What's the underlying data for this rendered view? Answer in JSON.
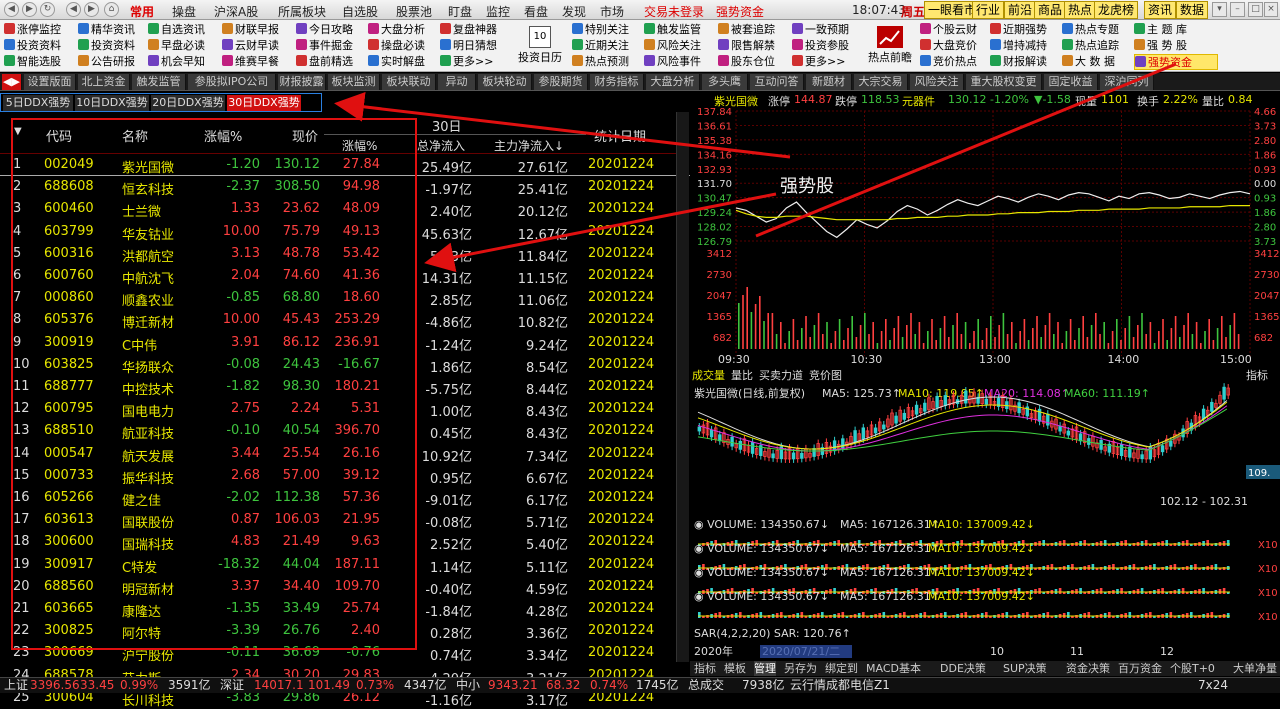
{
  "topbar": {
    "menus": [
      "常用",
      "操盘",
      "沪深A股",
      "所属板块",
      "自选股",
      "股票池",
      "盯盘",
      "监控",
      "看盘",
      "发现",
      "市场"
    ],
    "login": "交易未登录",
    "strong_fund": "强势资金",
    "clock": "18:07:43",
    "weekday": "周五",
    "right_tabs": [
      "一眼看市",
      "行业",
      "前沿",
      "商品",
      "热点",
      "龙虎榜",
      "资讯",
      "数据"
    ]
  },
  "toolbar": {
    "col1": [
      "涨停监控",
      "投资资料",
      "智能选股"
    ],
    "col2": [
      "精华资讯",
      "投资资料",
      "公告研报"
    ],
    "col3": [
      "自选资讯",
      "早盘必读",
      "机会早知"
    ],
    "col4": [
      "财联早报",
      "云财早读",
      "维赛早餐"
    ],
    "col5": [
      "今日攻略",
      "事件掘金",
      "盘前精选"
    ],
    "col6": [
      "大盘分析",
      "操盘必读",
      "实时解盘"
    ],
    "col7": [
      "复盘神器",
      "明日猜想",
      "更多>>"
    ],
    "cal_num": "10",
    "cal_label": "投资日历",
    "col8": [
      "特别关注",
      "近期关注",
      "热点预测"
    ],
    "col9": [
      "触发监管",
      "风险关注",
      "风险事件"
    ],
    "col10": [
      "被套追踪",
      "限售解禁",
      "股东仓位"
    ],
    "col11": [
      "一致预期",
      "投资参股",
      "更多>>"
    ],
    "hot_label": "热点前瞻",
    "col12": [
      "个股云财",
      "大盘竞价",
      "竞价热点"
    ],
    "col13": [
      "近期强势",
      "增持减持",
      "财报解读"
    ],
    "col14": [
      "热点专题",
      "热点追踪",
      "大 数 据"
    ],
    "col15": [
      "主 题 库",
      "强 势 股",
      "强势资金"
    ]
  },
  "tabs": [
    "设置版面",
    "北上资金",
    "触发监管",
    "参股拟IPO公司",
    "财报披露",
    "板块监测",
    "板块联动",
    "异动",
    "板块轮动",
    "参股期货",
    "财务指标",
    "大盘分析",
    "多头鹰",
    "互动问答",
    "新题材",
    "大宗交易",
    "风险关注",
    "重大股权变更",
    "固定收益",
    "深沪同列"
  ],
  "subtabs": [
    "5日DDX强势",
    "10日DDX强势",
    "20日DDX强势",
    "30日DDX强势"
  ],
  "table": {
    "group_header": "30日",
    "headers": [
      "代码",
      "名称",
      "涨幅%",
      "现价",
      "涨幅%",
      "总净流入",
      "主力净流入↓",
      "统计日期"
    ],
    "rows": [
      {
        "no": "1",
        "code": "002049",
        "name": "紫光国微",
        "pct": "-1.20",
        "price": "130.12",
        "p30": "27.84",
        "net": "25.49亿",
        "main": "27.61亿",
        "date": "20201224"
      },
      {
        "no": "2",
        "code": "688608",
        "name": "恒玄科技",
        "pct": "-2.37",
        "price": "308.50",
        "p30": "94.98",
        "net": "-1.97亿",
        "main": "25.41亿",
        "date": "20201224"
      },
      {
        "no": "3",
        "code": "600460",
        "name": "士兰微",
        "pct": "1.33",
        "price": "23.62",
        "p30": "48.09",
        "net": "2.40亿",
        "main": "20.12亿",
        "date": "20201224"
      },
      {
        "no": "4",
        "code": "603799",
        "name": "华友钴业",
        "pct": "10.00",
        "price": "75.79",
        "p30": "49.13",
        "net": "45.63亿",
        "main": "12.67亿",
        "date": "20201224"
      },
      {
        "no": "5",
        "code": "600316",
        "name": "洪都航空",
        "pct": "3.13",
        "price": "48.78",
        "p30": "53.42",
        "net": "5.53亿",
        "main": "11.84亿",
        "date": "20201224"
      },
      {
        "no": "6",
        "code": "600760",
        "name": "中航沈飞",
        "pct": "2.04",
        "price": "74.60",
        "p30": "41.36",
        "net": "14.31亿",
        "main": "11.15亿",
        "date": "20201224"
      },
      {
        "no": "7",
        "code": "000860",
        "name": "顺鑫农业",
        "pct": "-0.85",
        "price": "68.80",
        "p30": "18.60",
        "net": "2.85亿",
        "main": "11.06亿",
        "date": "20201224"
      },
      {
        "no": "8",
        "code": "605376",
        "name": "博迁新材",
        "pct": "10.00",
        "price": "45.43",
        "p30": "253.29",
        "net": "-4.86亿",
        "main": "10.82亿",
        "date": "20201224"
      },
      {
        "no": "9",
        "code": "300919",
        "name": "C中伟",
        "pct": "3.91",
        "price": "86.12",
        "p30": "236.91",
        "net": "-1.24亿",
        "main": "9.24亿",
        "date": "20201224"
      },
      {
        "no": "10",
        "code": "603825",
        "name": "华扬联众",
        "pct": "-0.08",
        "price": "24.43",
        "p30": "-16.67",
        "net": "1.86亿",
        "main": "8.54亿",
        "date": "20201224"
      },
      {
        "no": "11",
        "code": "688777",
        "name": "中控技术",
        "pct": "-1.82",
        "price": "98.30",
        "p30": "180.21",
        "net": "-5.75亿",
        "main": "8.44亿",
        "date": "20201224"
      },
      {
        "no": "12",
        "code": "600795",
        "name": "国电电力",
        "pct": "2.75",
        "price": "2.24",
        "p30": "5.31",
        "net": "1.00亿",
        "main": "8.43亿",
        "date": "20201224"
      },
      {
        "no": "13",
        "code": "688510",
        "name": "航亚科技",
        "pct": "-0.10",
        "price": "40.54",
        "p30": "396.70",
        "net": "0.45亿",
        "main": "8.43亿",
        "date": "20201224"
      },
      {
        "no": "14",
        "code": "000547",
        "name": "航天发展",
        "pct": "3.44",
        "price": "25.54",
        "p30": "26.16",
        "net": "10.92亿",
        "main": "7.34亿",
        "date": "20201224"
      },
      {
        "no": "15",
        "code": "000733",
        "name": "振华科技",
        "pct": "2.68",
        "price": "57.00",
        "p30": "39.12",
        "net": "0.95亿",
        "main": "6.67亿",
        "date": "20201224"
      },
      {
        "no": "16",
        "code": "605266",
        "name": "健之佳",
        "pct": "-2.02",
        "price": "112.38",
        "p30": "57.36",
        "net": "-9.01亿",
        "main": "6.17亿",
        "date": "20201224"
      },
      {
        "no": "17",
        "code": "603613",
        "name": "国联股份",
        "pct": "0.87",
        "price": "106.03",
        "p30": "21.95",
        "net": "-0.08亿",
        "main": "5.71亿",
        "date": "20201224"
      },
      {
        "no": "18",
        "code": "300600",
        "name": "国瑞科技",
        "pct": "4.83",
        "price": "21.49",
        "p30": "9.63",
        "net": "2.52亿",
        "main": "5.40亿",
        "date": "20201224"
      },
      {
        "no": "19",
        "code": "300917",
        "name": "C特发",
        "pct": "-18.32",
        "price": "44.04",
        "p30": "187.11",
        "net": "1.14亿",
        "main": "5.11亿",
        "date": "20201224"
      },
      {
        "no": "20",
        "code": "688560",
        "name": "明冠新材",
        "pct": "3.37",
        "price": "34.40",
        "p30": "109.70",
        "net": "-0.40亿",
        "main": "4.59亿",
        "date": "20201224"
      },
      {
        "no": "21",
        "code": "603665",
        "name": "康隆达",
        "pct": "-1.35",
        "price": "33.49",
        "p30": "25.74",
        "net": "-1.84亿",
        "main": "4.28亿",
        "date": "20201224"
      },
      {
        "no": "22",
        "code": "300825",
        "name": "阿尔特",
        "pct": "-3.39",
        "price": "26.76",
        "p30": "2.40",
        "net": "0.28亿",
        "main": "3.36亿",
        "date": "20201224"
      },
      {
        "no": "23",
        "code": "300669",
        "name": "沪宁股份",
        "pct": "-0.11",
        "price": "36.69",
        "p30": "-0.76",
        "net": "0.74亿",
        "main": "3.34亿",
        "date": "20201224"
      },
      {
        "no": "24",
        "code": "688578",
        "name": "艾力斯",
        "pct": "2.34",
        "price": "30.20",
        "p30": "29.83",
        "net": "-4.20亿",
        "main": "3.21亿",
        "date": "20201224"
      },
      {
        "no": "25",
        "code": "300604",
        "name": "长川科技",
        "pct": "-3.83",
        "price": "29.86",
        "p30": "26.12",
        "net": "-1.16亿",
        "main": "3.17亿",
        "date": "20201224"
      }
    ]
  },
  "annotation": "强势股",
  "quote": {
    "name": "紫光国微",
    "limit_up_label": "涨停",
    "limit_up": "144.87",
    "limit_dn_label": "跌停",
    "limit_dn": "118.53",
    "sector": "元器件",
    "price": "130.12",
    "pct": "-1.20%",
    "chg": "▼-1.58",
    "vol_label": "现量",
    "vol": "1101",
    "turnover_label": "换手",
    "turnover": "2.22%",
    "ratio_label": "量比",
    "ratio": "0.84"
  },
  "intraday": {
    "left_ticks": [
      "137.84",
      "136.61",
      "135.38",
      "134.16",
      "132.93",
      "131.70",
      "130.47",
      "129.24",
      "128.02",
      "126.79"
    ],
    "right_ticks": [
      "4.66",
      "3.73",
      "2.80",
      "1.86",
      "0.93",
      "0.00",
      "0.93",
      "1.86",
      "2.80",
      "3.73"
    ],
    "vol_ticks": [
      "3412",
      "2730",
      "2047",
      "1365",
      "682"
    ],
    "time_ticks": [
      "09:30",
      "10:30",
      "13:00",
      "14:00",
      "15:00"
    ],
    "price_series": [
      129.6,
      129.4,
      128.9,
      128.4,
      128.7,
      129.6,
      130.1,
      129.2,
      128.4,
      127.6,
      127.1,
      127.8,
      128.6,
      128.2,
      127.9,
      128.5,
      129.3,
      129.8,
      129.5,
      129.0,
      129.4,
      129.9,
      130.3,
      130.0,
      129.8,
      130.2,
      130.6,
      130.4,
      130.1,
      130.5,
      130.8,
      130.6,
      130.3,
      130.7,
      130.9,
      130.8,
      130.5,
      130.2,
      130.6,
      130.4,
      130.8,
      130.9,
      130.7,
      130.4,
      130.5,
      130.8,
      130.6,
      130.4,
      130.7,
      130.9,
      131.0,
      130.8
    ],
    "avg_series": [
      129.4,
      129.1,
      128.9,
      128.8,
      128.8,
      128.9,
      128.9,
      128.9,
      128.8,
      128.7,
      128.6,
      128.6,
      128.6,
      128.6,
      128.6,
      128.6,
      128.7,
      128.7,
      128.8,
      128.8,
      128.8,
      128.9,
      128.9,
      129.0,
      129.0,
      129.0,
      129.1,
      129.1,
      129.2,
      129.2,
      129.2,
      129.3,
      129.3,
      129.3,
      129.4,
      129.4,
      129.4,
      129.5,
      129.5,
      129.5,
      129.5,
      129.6,
      129.6,
      129.6,
      129.6,
      129.7,
      129.7,
      129.7,
      129.7,
      129.8,
      129.8,
      129.8
    ]
  },
  "subtabs_right": [
    "成交量",
    "量比",
    "买卖力道",
    "竞价图"
  ],
  "indicator_btn": "指标",
  "kline": {
    "title": "紫光国微(日线,前复权)",
    "ma5": "MA5: 125.73↑",
    "ma10": "MA10: 119.85↑",
    "ma20": "MA20: 114.08↑",
    "ma60": "MA60: 111.19↑",
    "range_label": "102.12 - 102.31",
    "right_tick": "109.",
    "date_ticks": [
      "2020年",
      "2020/07/21/二",
      "10",
      "11",
      "12"
    ]
  },
  "volume_rows": [
    {
      "v": "VOLUME: 134350.67↓",
      "ma5": "MA5: 167126.31↑",
      "ma10": "MA10: 137009.42↓",
      "tick": "X10"
    },
    {
      "v": "VOLUME: 134350.67↓",
      "ma5": "MA5: 167126.31↑",
      "ma10": "MA10: 137009.42↓",
      "tick": "X10"
    },
    {
      "v": "VOLUME: 134350.67↓",
      "ma5": "MA5: 167126.31↑",
      "ma10": "MA10: 137009.42↓",
      "tick": "X10"
    },
    {
      "v": "VOLUME: 134350.67↓",
      "ma5": "MA5: 167126.31↑",
      "ma10": "MA10: 137009.42↓",
      "tick": "X10"
    }
  ],
  "sar": "SAR(4,2,2,20)  SAR: 120.76↑",
  "bottom_tabs": [
    "指标",
    "模板",
    "管理",
    "另存为",
    "绑定到",
    "MACD基本",
    "DDE决策",
    "SUP决策",
    "资金决策",
    "百万资金",
    "个股T+0",
    "大单净量"
  ],
  "status": {
    "sh_label": "上证",
    "sh": "3396.56",
    "sh_chg": "33.45",
    "sh_pct": "0.99%",
    "sh_amt": "3591亿",
    "sz_label": "深证",
    "sz": "14017.1",
    "sz_chg": "101.49",
    "sz_pct": "0.73%",
    "sz_amt": "4347亿",
    "zx_label": "中小",
    "zx": "9343.21",
    "zx_chg": "68.32",
    "zx_pct": "0.74%",
    "zx_amt": "1745亿",
    "total_label": "总成交",
    "total": "7938亿",
    "server": "云行情成都电信Z1",
    "period": "7x24"
  },
  "colors": {
    "up": "#ff4040",
    "down": "#3ec43e",
    "code": "#e6e600",
    "accent": "#d01010",
    "box": "#2a7fe0"
  }
}
